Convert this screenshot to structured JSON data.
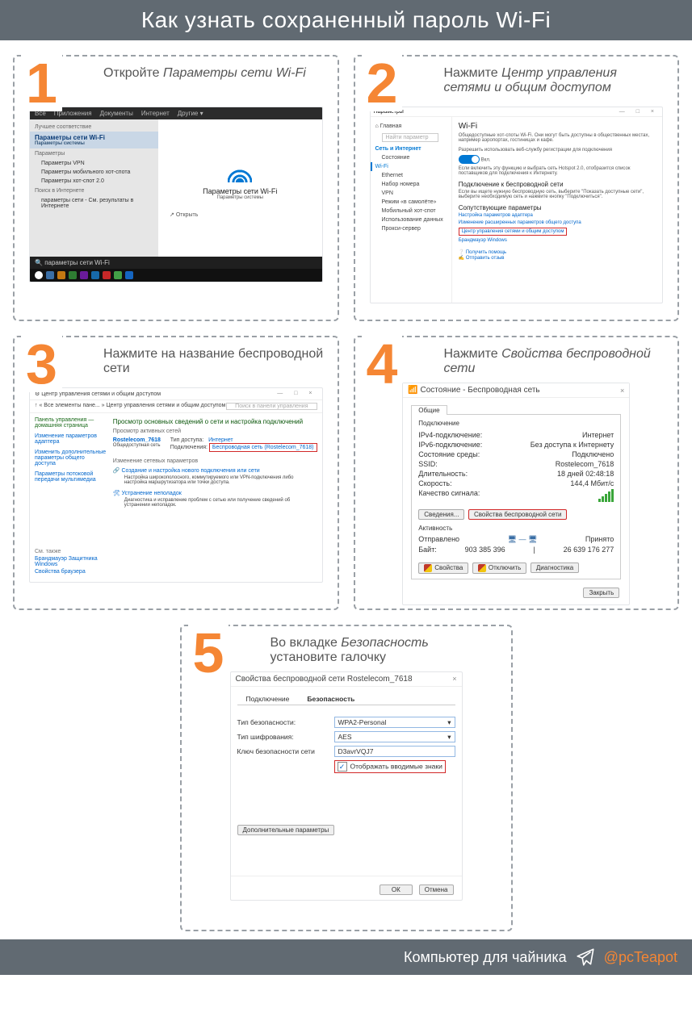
{
  "title": "Как узнать сохраненный пароль Wi-Fi",
  "footer": {
    "text": "Компьютер для чайника",
    "handle": "@pcTeapot"
  },
  "steps": {
    "s1": {
      "num": "1",
      "caption_pre": "Откройте ",
      "caption_em": "Параметры сети Wi-Fi",
      "top_tabs": [
        "Все",
        "Приложения",
        "Документы",
        "Интернет",
        "Другие ▾"
      ],
      "best_match": "Лучшее соответствие",
      "selected": "Параметры сети Wi-Fi",
      "selected_sub": "Параметры системы",
      "cat_params": "Параметры",
      "items": [
        "Параметры VPN",
        "Параметры мобильного хот-спота",
        "Параметры хот-спот 2.0"
      ],
      "search_in_net": "Поиск в Интернете",
      "search_item": "параметры сети - См. результаты в Интернете",
      "right_title": "Параметры сети Wi-Fi",
      "right_sub": "Параметры системы",
      "open": "Открыть",
      "search_value": "параметры сети Wi-Fi"
    },
    "s2": {
      "num": "2",
      "caption_pre": "Нажмите ",
      "caption_em": "Центр управления сетями и общим доступом",
      "window": "Параметры",
      "home": "Главная",
      "search_ph": "Найти параметр",
      "section": "Сеть и Интернет",
      "side": [
        "Состояние",
        "Wi-Fi",
        "Ethernet",
        "Набор номера",
        "VPN",
        "Режим «в самолёте»",
        "Мобильный хот-спот",
        "Использование данных",
        "Прокси-сервер"
      ],
      "h_wifi": "Wi-Fi",
      "p1": "Общедоступные хот-споты Wi-Fi. Они могут быть доступны в общественных местах, например аэропортах, гостиницах и кафе.",
      "p2": "Разрешить использовать веб-службу регистрации для подключения",
      "toggle": "Вкл.",
      "p3": "Если включить эту функцию и выбрать сеть Hotspot 2.0, отобразится список поставщиков для подключения к Интернету.",
      "h_conn": "Подключение к беспроводной сети",
      "p4": "Если вы ищете нужную беспроводную сеть, выберите \"Показать доступные сети\", выберите необходимую сеть и нажмите кнопку \"Подключиться\".",
      "h_rel": "Сопутствующие параметры",
      "links": [
        "Настройка параметров адаптера",
        "Изменение расширенных параметров общего доступа"
      ],
      "link_boxed": "Центр управления сетями и общим доступом",
      "link_after": "Брандмауэр Windows",
      "help": "Получить помощь",
      "feedback": "Отправить отзыв"
    },
    "s3": {
      "num": "3",
      "caption_pre": "Нажмите на название беспроводной сети",
      "title": "Центр управления сетями и общим доступом",
      "crumbs": "↑  « Все элементы пане... » Центр управления сетями и общим доступом",
      "search_ph": "Поиск в панели управления",
      "sidebar_title": "Панель управления — домашняя страница",
      "side": [
        "Изменение параметров адаптера",
        "Изменить дополнительные параметры общего доступа",
        "Параметры потоковой передачи мультимедиа"
      ],
      "head": "Просмотр основных сведений о сети и настройка подключений",
      "active": "Просмотр активных сетей",
      "net_name": "Rostelecom_7618",
      "net_type": "Общедоступная сеть",
      "access_l": "Тип доступа:",
      "access_v": "Интернет",
      "conn_l": "Подключения:",
      "conn_v": "Беспроводная сеть (Rostelecom_7618)",
      "change": "Изменение сетевых параметров",
      "new_t": "Создание и настройка нового подключения или сети",
      "new_d": "Настройка широкополосного, коммутируемого или VPN-подключения либо настройка маршрутизатора или точки доступа.",
      "fix_t": "Устранение неполадок",
      "fix_d": "Диагностика и исправление проблем с сетью или получение сведений об устранении неполадок.",
      "see": "См. также",
      "see_1": "Брандмауэр Защитника Windows",
      "see_2": "Свойства браузера"
    },
    "s4": {
      "num": "4",
      "caption_pre": "Нажмите ",
      "caption_em": "Свойства беспроводной сети",
      "title": "Состояние - Беспроводная сеть",
      "tab": "Общие",
      "grp_conn": "Подключение",
      "rows": [
        [
          "IPv4-подключение:",
          "Интернет"
        ],
        [
          "IPv6-подключение:",
          "Без доступа к Интернету"
        ],
        [
          "Состояние среды:",
          "Подключено"
        ],
        [
          "SSID:",
          "Rostelecom_7618"
        ],
        [
          "Длительность:",
          "18 дней 02:48:18"
        ],
        [
          "Скорость:",
          "144,4 Мбит/c"
        ]
      ],
      "signal_l": "Качество сигнала:",
      "btn_det": "Сведения...",
      "btn_props": "Свойства беспроводной сети",
      "grp_act": "Активность",
      "sent": "Отправлено",
      "recv": "Принято",
      "byte_l": "Байт:",
      "byte_s": "903 385 396",
      "byte_r": "26 639 176 277",
      "b_props": "Свойства",
      "b_off": "Отключить",
      "b_diag": "Диагностика",
      "close": "Закрыть"
    },
    "s5": {
      "num": "5",
      "caption_pre": "Во вкладке ",
      "caption_em": "Безопасность",
      "caption_post": " установите галочку",
      "title": "Свойства беспроводной сети Rostelecom_7618",
      "tab1": "Подключение",
      "tab2": "Безопасность",
      "sec_type_l": "Тип безопасности:",
      "sec_type_v": "WPA2-Personal",
      "enc_l": "Тип шифрования:",
      "enc_v": "AES",
      "key_l": "Ключ безопасности сети",
      "key_v": "D3avrVQJ7",
      "chk": "Отображать вводимые знаки",
      "adv": "Дополнительные параметры",
      "ok": "ОК",
      "cancel": "Отмена"
    }
  }
}
